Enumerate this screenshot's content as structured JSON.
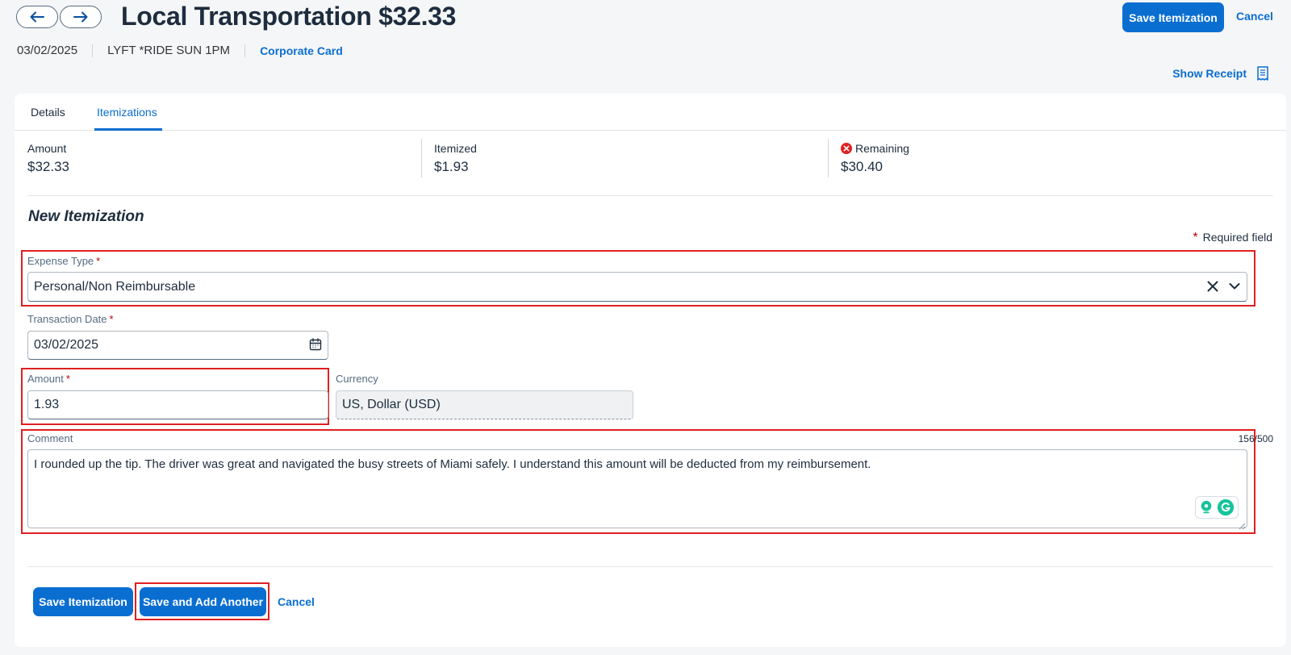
{
  "header": {
    "title": "Local Transportation $32.33",
    "save_label": "Save Itemization",
    "cancel_label": "Cancel",
    "date": "03/02/2025",
    "merchant": "LYFT *RIDE SUN 1PM",
    "payment_type": "Corporate Card",
    "show_receipt_label": "Show Receipt"
  },
  "tabs": [
    {
      "label": "Details",
      "active": false
    },
    {
      "label": "Itemizations",
      "active": true
    }
  ],
  "summary": {
    "amount_label": "Amount",
    "amount_value": "$32.33",
    "itemized_label": "Itemized",
    "itemized_value": "$1.93",
    "remaining_label": "Remaining",
    "remaining_value": "$30.40"
  },
  "form": {
    "section_title": "New Itemization",
    "required_note": "Required field",
    "required_star": "*",
    "expense_type_label": "Expense Type",
    "expense_type_value": "Personal/Non Reimbursable",
    "transaction_date_label": "Transaction Date",
    "transaction_date_value": "03/02/2025",
    "amount_label": "Amount",
    "amount_value": "1.93",
    "currency_label": "Currency",
    "currency_value": "US, Dollar (USD)",
    "comment_label": "Comment",
    "comment_counter": "156/500",
    "comment_value": "I rounded up the tip. The driver was great and navigated the busy streets of Miami safely. I understand this amount will be deducted from my reimbursement."
  },
  "footer": {
    "save_label": "Save Itemization",
    "save_add_label": "Save and Add Another",
    "cancel_label": "Cancel"
  },
  "colors": {
    "accent": "#0a6ed1",
    "error": "#bb0000",
    "highlight": "#e02020",
    "grammarly": "#15c39a"
  }
}
